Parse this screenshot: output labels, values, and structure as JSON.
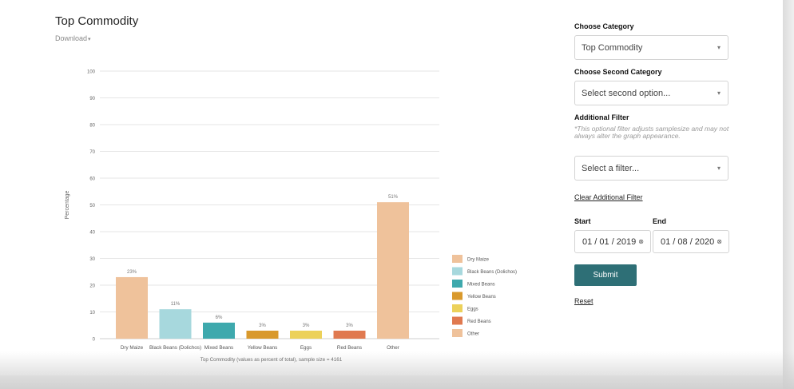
{
  "chart_card": {
    "title": "Top Commodity",
    "download_label": "Download",
    "download_caret": "▾"
  },
  "chart_data": {
    "type": "bar",
    "title": "Top Commodity",
    "xlabel": "Top Commodity (values as percent of total), sample size = 4161",
    "ylabel": "Percentage",
    "ylim": [
      0,
      100
    ],
    "yticks": [
      0,
      10,
      20,
      30,
      40,
      50,
      60,
      70,
      80,
      90,
      100
    ],
    "categories": [
      "Dry Maize",
      "Black Beans (Dolichos)",
      "Mixed Beans",
      "Yellow Beans",
      "Eggs",
      "Red Beans",
      "Other"
    ],
    "tick_labels": [
      "Dry Maize",
      "Black Beans (Dolichos)",
      "Mixed Beans",
      "Yellow Beans",
      "Eggs",
      "Red Beans",
      "Other"
    ],
    "values": [
      23,
      11,
      6,
      3,
      3,
      3,
      51
    ],
    "value_labels": [
      "23%",
      "11%",
      "6%",
      "3%",
      "3%",
      "3%",
      "51%"
    ],
    "colors": [
      "#efc29b",
      "#a7d8dd",
      "#3ea9ad",
      "#d9992c",
      "#ecd15a",
      "#e0794f",
      "#efc29b"
    ],
    "legend": {
      "position": "right",
      "entries": [
        "Dry Maize",
        "Black Beans (Dolichos)",
        "Mixed Beans",
        "Yellow Beans",
        "Eggs",
        "Red Beans",
        "Other"
      ]
    },
    "grid": true
  },
  "filters": {
    "category_label": "Choose Category",
    "category_value": "Top Commodity",
    "second_category_label": "Choose Second Category",
    "second_category_placeholder": "Select second option...",
    "additional_filter_label": "Additional Filter",
    "additional_filter_hint": "*This optional filter adjusts samplesize and may not always alter the graph appearance.",
    "additional_filter_placeholder": "Select a filter...",
    "clear_filter_link": "Clear Additional Filter",
    "start_label": "Start",
    "end_label": "End",
    "start_date": "01 / 01 / 2019",
    "end_date": "01 / 08 / 2020",
    "submit_label": "Submit",
    "reset_label": "Reset",
    "chevron": "▾",
    "date_icon": "⊗"
  }
}
